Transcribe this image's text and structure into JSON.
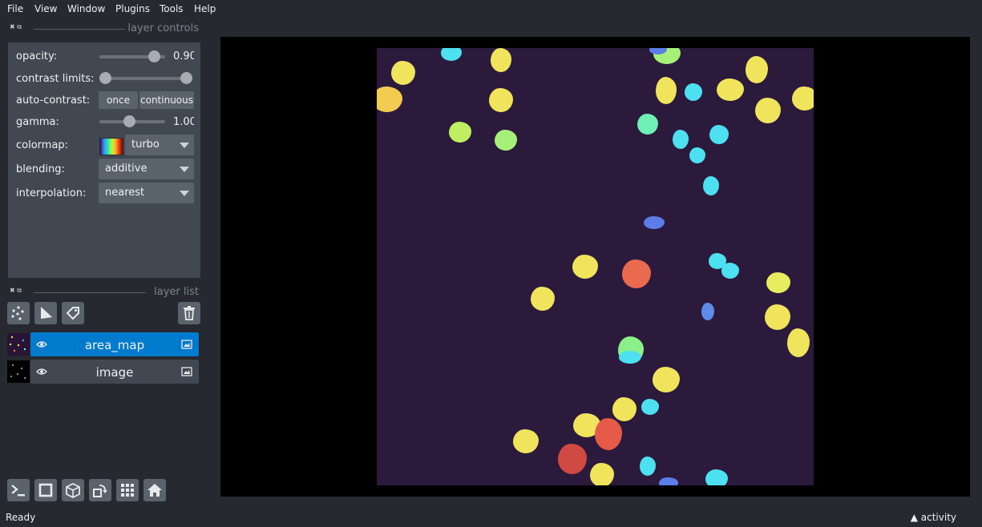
{
  "menu": [
    "File",
    "View",
    "Window",
    "Plugins",
    "Tools",
    "Help"
  ],
  "layer_controls": {
    "title": "layer controls",
    "opacity_label": "opacity:",
    "opacity_value": "0.90",
    "contrast_limits_label": "contrast limits:",
    "auto_contrast_label": "auto-contrast:",
    "once_label": "once",
    "continuous_label": "continuous",
    "gamma_label": "gamma:",
    "gamma_value": "1.00",
    "colormap_label": "colormap:",
    "colormap_value": "turbo",
    "blending_label": "blending:",
    "blending_value": "additive",
    "interpolation_label": "interpolation:",
    "interpolation_value": "nearest"
  },
  "layer_list": {
    "title": "layer list",
    "layers": [
      {
        "name": "area_map",
        "selected": true,
        "visible": true
      },
      {
        "name": "image",
        "selected": false,
        "visible": true
      }
    ]
  },
  "status": {
    "ready": "Ready",
    "activity": "activity"
  },
  "colors": {
    "background": "#262930",
    "panel": "#414851",
    "button": "#5a626c",
    "selected_layer": "#007acc",
    "image_background": "#2c1a3c"
  },
  "icons": [
    "points-icon",
    "shapes-icon",
    "labels-icon",
    "delete-icon",
    "eye-icon",
    "image-layer-icon",
    "console-icon",
    "square-view-icon",
    "3d-view-icon",
    "roll-dims-icon",
    "grid-icon",
    "home-icon"
  ]
}
